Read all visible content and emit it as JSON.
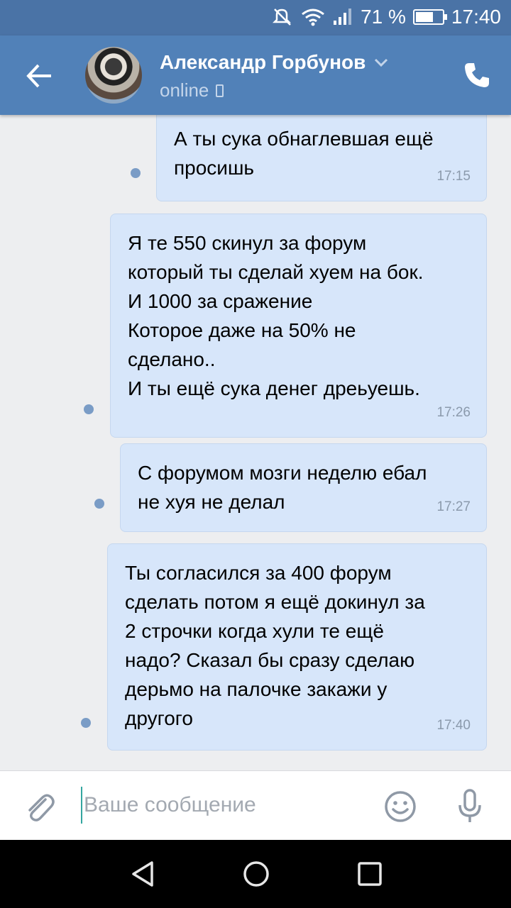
{
  "status_bar": {
    "battery_percent": "71 %",
    "battery_level": 0.71,
    "time": "17:40"
  },
  "header": {
    "contact_name": "Александр Горбунов",
    "presence": "online"
  },
  "messages": [
    {
      "text": "А ты сука обнаглевшая ещё\nпросишь",
      "time": "17:15"
    },
    {
      "text": "Я те 550 скинул за форум\nкоторый ты сделай хуем на бок.\nИ 1000 за сражение\nКоторое даже на 50% не\nсделано..\nИ ты ещё сука денег дреьуешь.",
      "time": "17:26"
    },
    {
      "text": "С форумом мозги неделю ебал\nне хуя не делал",
      "time": "17:27"
    },
    {
      "text": "Ты согласился за 400 форум\nсделать потом я ещё докинул за\n2 строчки когда хули те ещё\nнадо? Сказал бы сразу сделаю\nдерьмо на палочке закажи у\nдругого",
      "time": "17:40"
    }
  ],
  "composer": {
    "placeholder": "Ваше сообщение",
    "value": ""
  },
  "icons": {
    "back": "arrow-left-icon",
    "call": "phone-icon",
    "device": "mobile-device-icon",
    "attach": "paperclip-icon",
    "emoji": "smiley-icon",
    "voice": "microphone-icon",
    "nav_back": "triangle-back-icon",
    "nav_home": "circle-home-icon",
    "nav_recent": "square-recent-icon"
  },
  "colors": {
    "header": "#5181b8",
    "status_bar": "#4a73a6",
    "bubble": "#d7e6fa",
    "unread_dot": "#7a9cc6",
    "background": "#edeef0"
  }
}
